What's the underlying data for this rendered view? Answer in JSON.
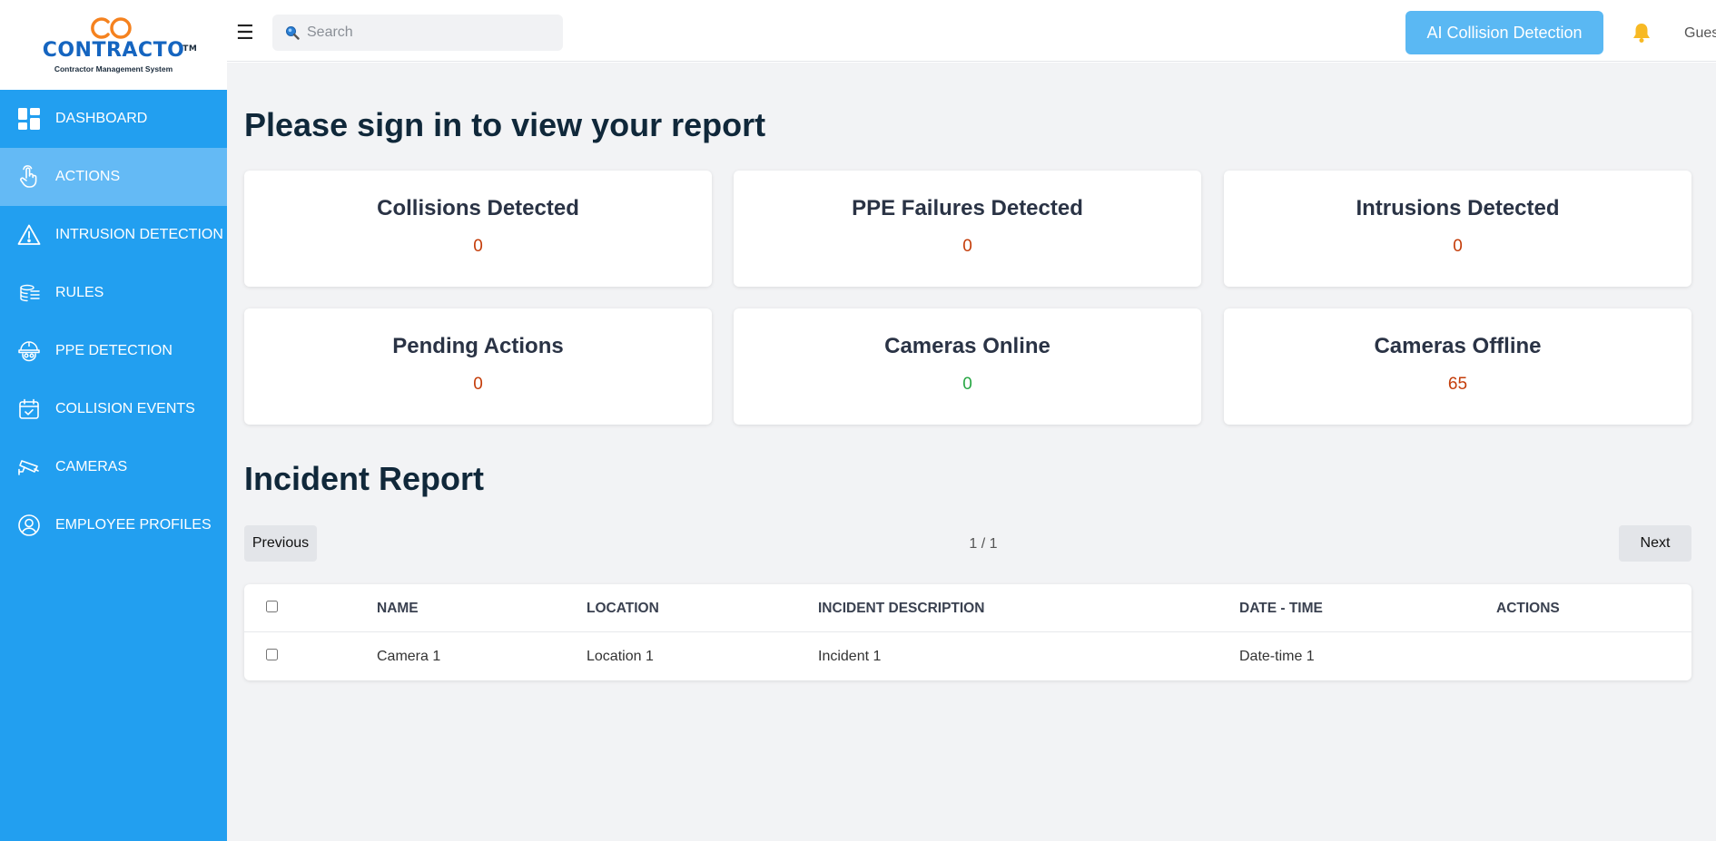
{
  "logo": {
    "name": "CONTRACTO",
    "tm": "TM",
    "subtitle": "Contractor Management System"
  },
  "sidebar": {
    "items": [
      {
        "label": "DASHBOARD",
        "icon": "dashboard-icon",
        "active": false
      },
      {
        "label": "ACTIONS",
        "icon": "hand-pointer-icon",
        "active": true
      },
      {
        "label": "INTRUSION DETECTION",
        "icon": "warning-icon",
        "active": false
      },
      {
        "label": "RULES",
        "icon": "rules-icon",
        "active": false
      },
      {
        "label": "PPE DETECTION",
        "icon": "hard-hat-icon",
        "active": false
      },
      {
        "label": "COLLISION EVENTS",
        "icon": "calendar-check-icon",
        "active": false
      },
      {
        "label": "CAMERAS",
        "icon": "camera-icon",
        "active": false
      },
      {
        "label": "EMPLOYEE PROFILES",
        "icon": "user-circle-icon",
        "active": false
      }
    ]
  },
  "topbar": {
    "menu_icon": "☰",
    "search_placeholder": "Search",
    "ai_button": "AI Collision Detection",
    "user": "Guest"
  },
  "main": {
    "title": "Please sign in to view your report",
    "stats": [
      {
        "label": "Collisions Detected",
        "value": "0",
        "status": "red"
      },
      {
        "label": "PPE Failures Detected",
        "value": "0",
        "status": "red"
      },
      {
        "label": "Intrusions Detected",
        "value": "0",
        "status": "red"
      },
      {
        "label": "Pending Actions",
        "value": "0",
        "status": "red"
      },
      {
        "label": "Cameras Online",
        "value": "0",
        "status": "green"
      },
      {
        "label": "Cameras Offline",
        "value": "65",
        "status": "red"
      }
    ],
    "report": {
      "title": "Incident Report",
      "previous": "Previous",
      "next": "Next",
      "page_info": "1 / 1",
      "columns": [
        "NAME",
        "LOCATION",
        "INCIDENT DESCRIPTION",
        "DATE - TIME",
        "ACTIONS"
      ],
      "rows": [
        [
          "Camera 1",
          "Location 1",
          "Incident 1",
          "Date-time 1",
          ""
        ]
      ]
    }
  },
  "colors": {
    "sidebar": "#229ff0",
    "sidebar_active": "#64baf5",
    "accent_button": "#5ab8f3",
    "value_red": "#c43d0a",
    "value_green": "#28a745",
    "logo_orange": "#f5821f",
    "logo_blue": "#1565c0"
  }
}
